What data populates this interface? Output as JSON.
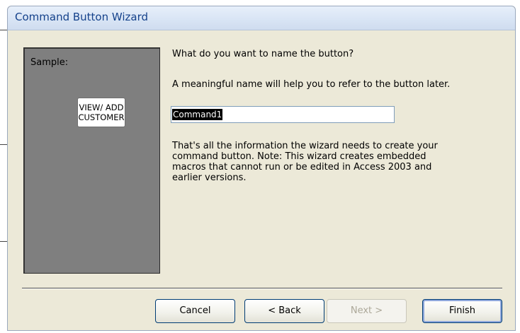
{
  "window": {
    "title": "Command Button Wizard"
  },
  "sample": {
    "label": "Sample:",
    "button_line1": "VIEW/ ADD",
    "button_line2": "CUSTOMER"
  },
  "prompt": {
    "question": "What do you want to name the button?",
    "hint": "A meaningful name will help you to refer to the button later."
  },
  "name_field": {
    "value": "Command1"
  },
  "info": {
    "line1": "That's all the information the wizard needs to create your",
    "line2": "command button. Note: This wizard creates embedded",
    "line3": "macros that cannot run or be edited in Access 2003 and",
    "line4": "earlier versions."
  },
  "buttons": {
    "cancel": "Cancel",
    "back": "< Back",
    "next": "Next >",
    "finish": "Finish"
  },
  "colors": {
    "title_text": "#15428b",
    "sample_panel": "#7f7f7f",
    "dialog_bg": "#ece9d8",
    "selection": "#000000"
  }
}
